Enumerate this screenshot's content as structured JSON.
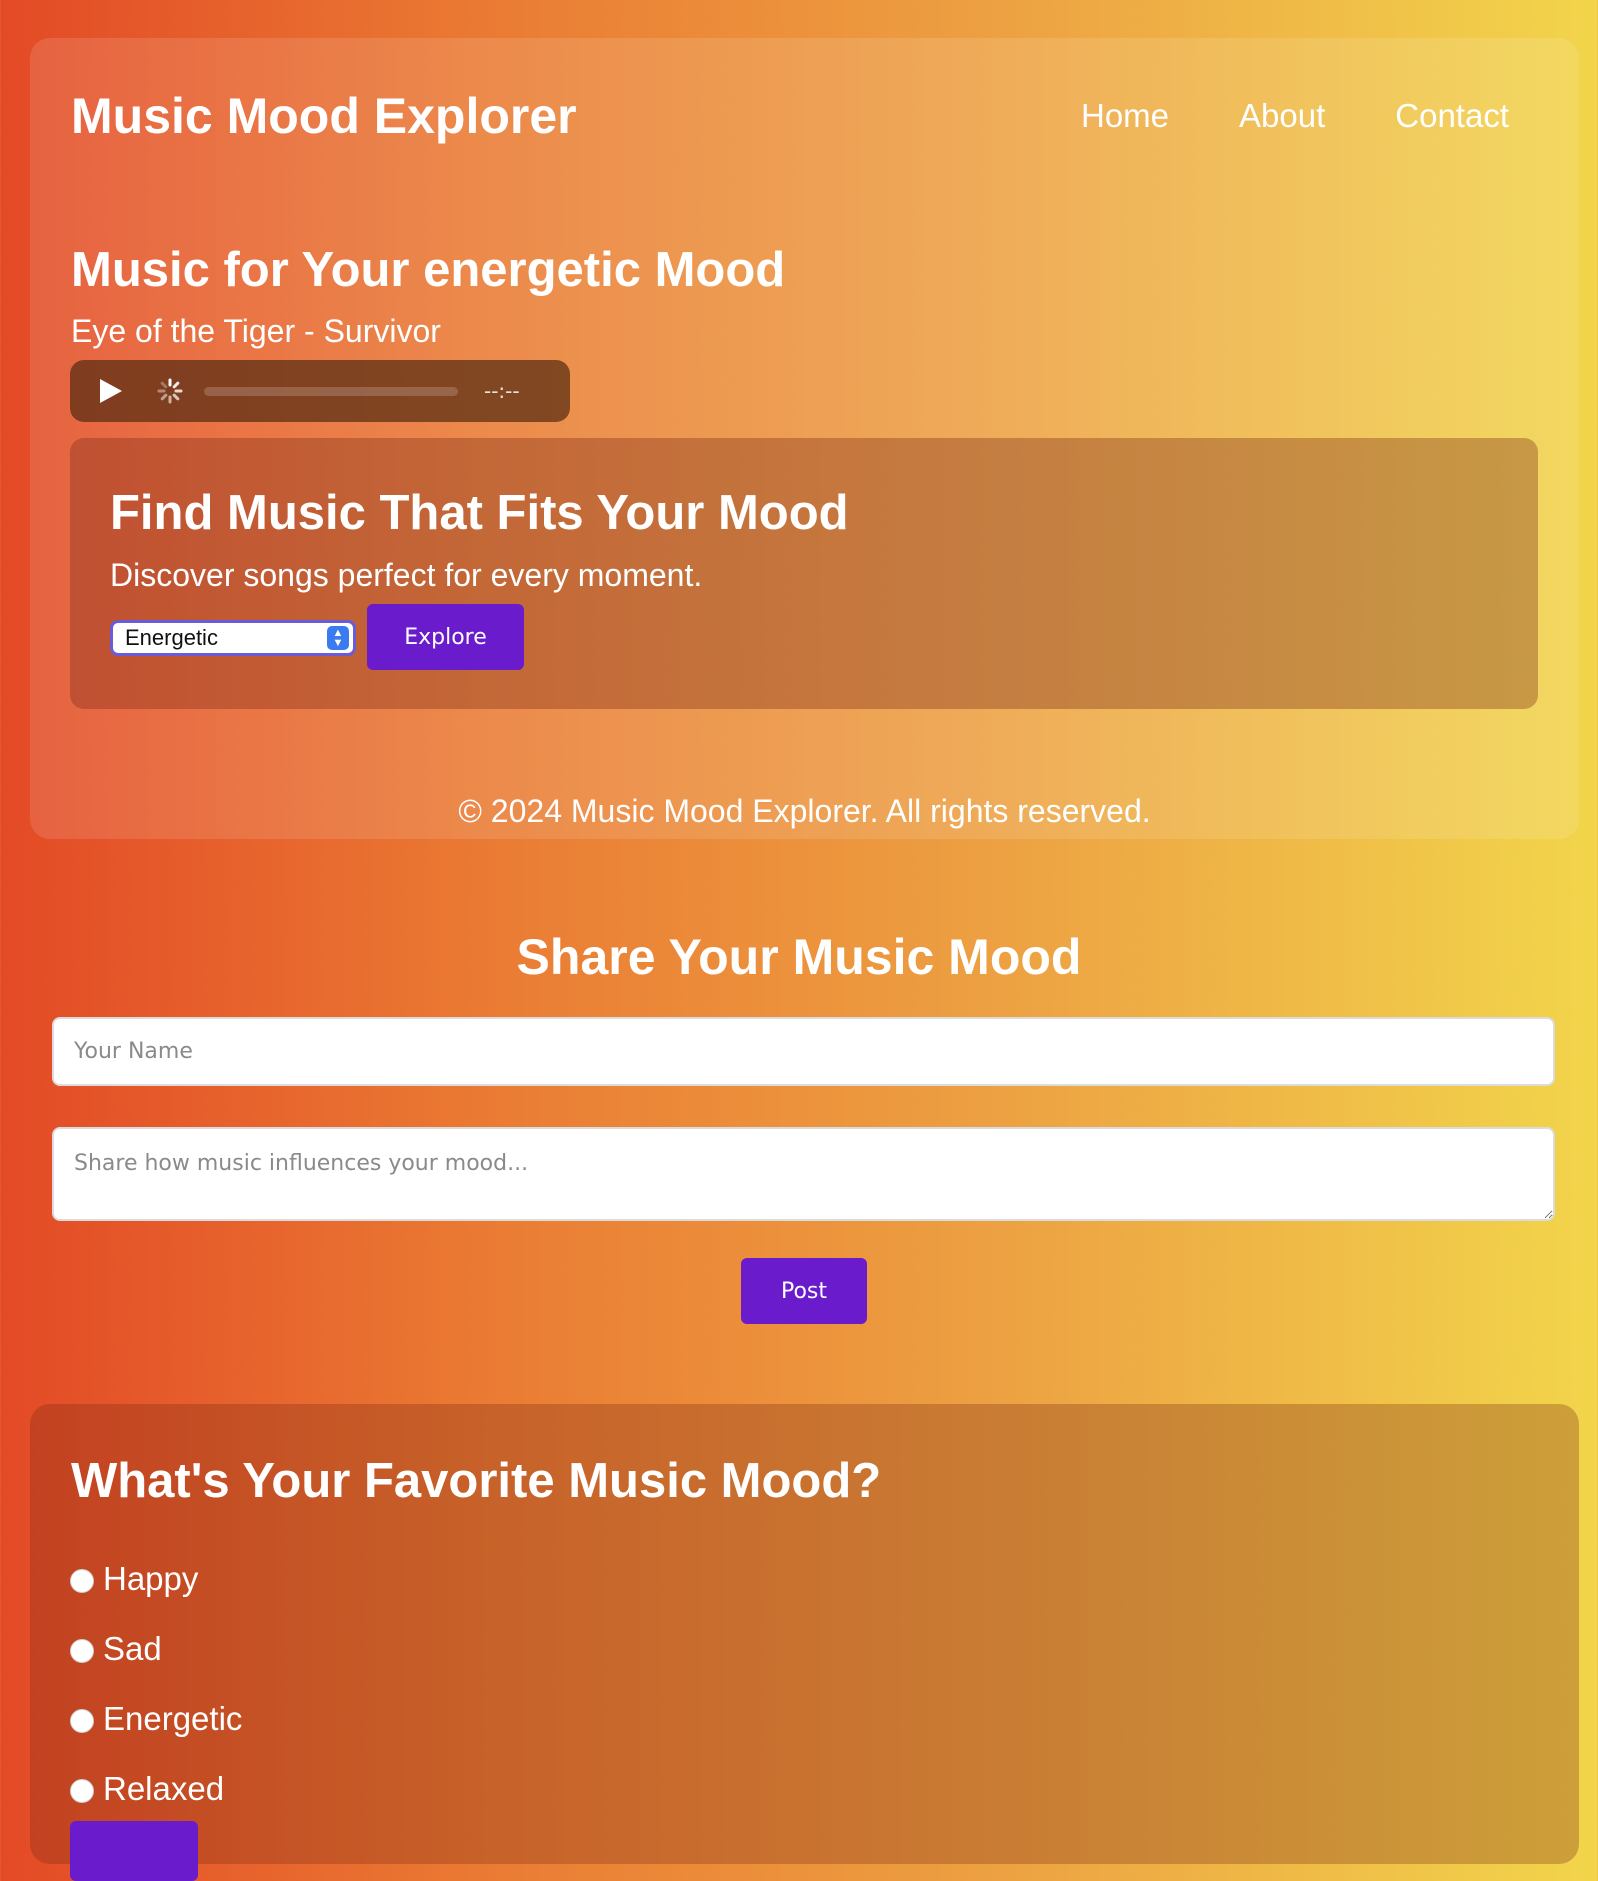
{
  "header": {
    "title": "Music Mood Explorer",
    "nav": [
      "Home",
      "About",
      "Contact"
    ]
  },
  "now_playing": {
    "heading": "Music for Your energetic Mood",
    "song": "Eye of the Tiger - Survivor",
    "time": "--:--"
  },
  "finder": {
    "title": "Find Music That Fits Your Mood",
    "subtitle": "Discover songs perfect for every moment.",
    "selected_mood": "Energetic",
    "explore_label": "Explore"
  },
  "footer": {
    "text": "© 2024 Music Mood Explorer. All rights reserved."
  },
  "share": {
    "title": "Share Your Music Mood",
    "name_placeholder": "Your Name",
    "message_placeholder": "Share how music influences your mood...",
    "post_label": "Post"
  },
  "poll": {
    "title": "What's Your Favorite Music Mood?",
    "options": [
      "Happy",
      "Sad",
      "Energetic",
      "Relaxed"
    ]
  },
  "colors": {
    "accent": "#6a1bcc",
    "gradient_start": "#e34a26",
    "gradient_end": "#f2d54b"
  }
}
